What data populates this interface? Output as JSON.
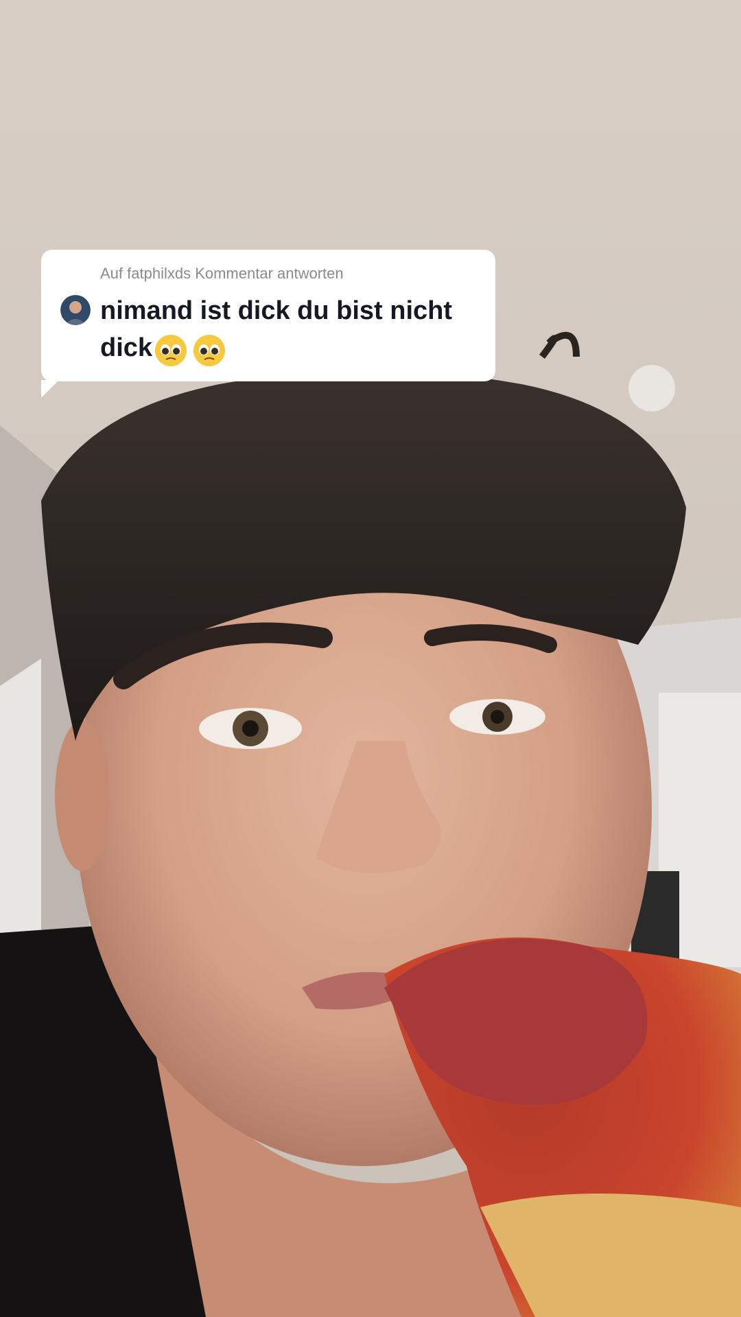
{
  "reply_sticker": {
    "header": "Auf fatphilxds Kommentar antworten",
    "comment_text": "nimand ist dick du bist nicht dick",
    "emojis": [
      "pleading-face-icon",
      "pleading-face-icon"
    ]
  }
}
